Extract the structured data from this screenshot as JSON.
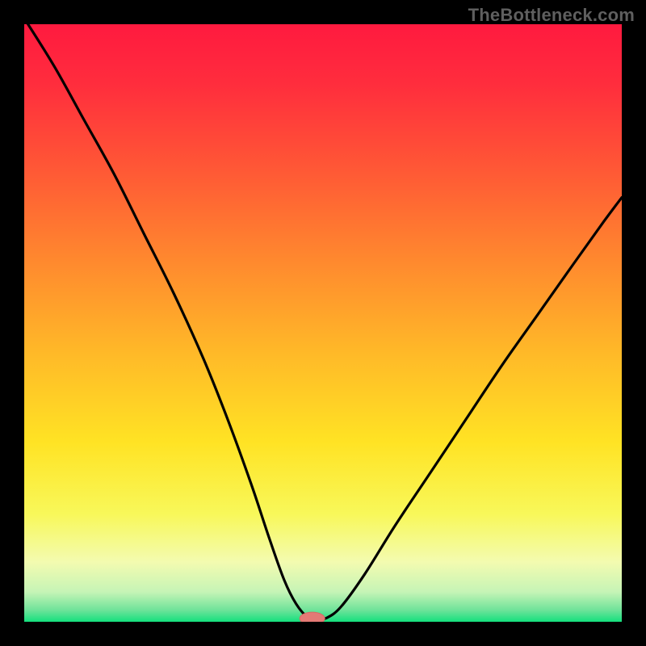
{
  "watermark": "TheBottleneck.com",
  "colors": {
    "gradient_stops": [
      {
        "offset": 0.0,
        "color": "#ff1a3f"
      },
      {
        "offset": 0.1,
        "color": "#ff2d3d"
      },
      {
        "offset": 0.25,
        "color": "#ff5a35"
      },
      {
        "offset": 0.4,
        "color": "#ff8a2e"
      },
      {
        "offset": 0.55,
        "color": "#ffb928"
      },
      {
        "offset": 0.7,
        "color": "#ffe324"
      },
      {
        "offset": 0.82,
        "color": "#f8f85a"
      },
      {
        "offset": 0.9,
        "color": "#f3fbb0"
      },
      {
        "offset": 0.95,
        "color": "#c6f4b6"
      },
      {
        "offset": 0.98,
        "color": "#70e39a"
      },
      {
        "offset": 1.0,
        "color": "#14e07d"
      }
    ],
    "curve": "#000000",
    "marker_fill": "#e47a75",
    "marker_stroke": "#d66a65",
    "frame": "#000000"
  },
  "chart_data": {
    "type": "line",
    "title": "",
    "xlabel": "",
    "ylabel": "",
    "xlim": [
      0,
      100
    ],
    "ylim": [
      0,
      100
    ],
    "note": "Bottleneck-style dip curve. x is normalized horizontal position (0=left,100=right), y is normalized mismatch (0=bottom/green,100=top/red). Minimum near x≈48.",
    "series": [
      {
        "name": "bottleneck_curve",
        "x": [
          0,
          5,
          10,
          15,
          20,
          25,
          30,
          34,
          38,
          41,
          43.5,
          45.5,
          47.5,
          49,
          50.5,
          53,
          57,
          62,
          68,
          74,
          80,
          86,
          92,
          97,
          100
        ],
        "y": [
          101,
          93,
          84,
          75,
          65,
          55,
          44,
          34,
          23,
          14,
          7,
          3,
          0.7,
          0.5,
          0.6,
          2.5,
          8,
          16,
          25,
          34,
          43,
          51.5,
          60,
          67,
          71
        ]
      }
    ],
    "marker": {
      "x": 48.2,
      "y": 0.55,
      "rx": 2.1,
      "ry": 1.05
    }
  }
}
